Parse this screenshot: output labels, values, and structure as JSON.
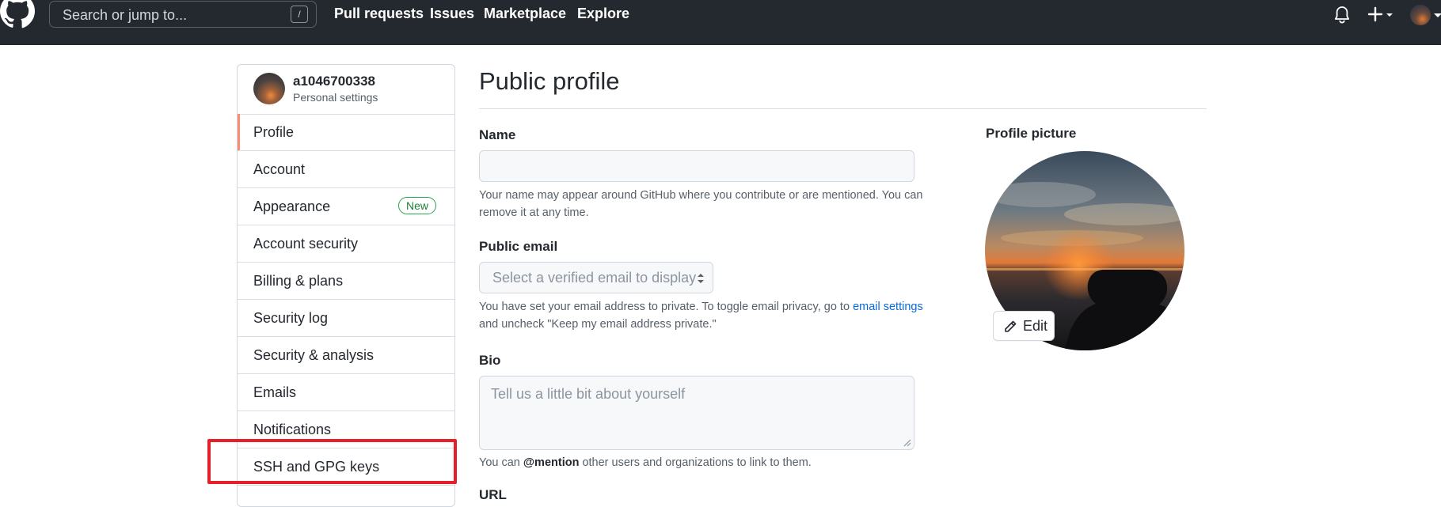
{
  "header": {
    "search_placeholder": "Search or jump to...",
    "search_shortcut": "/",
    "nav": [
      "Pull requests",
      "Issues",
      "Marketplace",
      "Explore"
    ],
    "icons": [
      "github-logo-icon",
      "bell-icon",
      "plus-icon",
      "caret-down-icon",
      "avatar"
    ]
  },
  "sidebar": {
    "username": "a1046700338",
    "subtitle": "Personal settings",
    "items": [
      {
        "label": "Profile",
        "active": true
      },
      {
        "label": "Account"
      },
      {
        "label": "Appearance",
        "badge": "New"
      },
      {
        "label": "Account security"
      },
      {
        "label": "Billing & plans"
      },
      {
        "label": "Security log"
      },
      {
        "label": "Security & analysis"
      },
      {
        "label": "Emails"
      },
      {
        "label": "Notifications"
      },
      {
        "label": "SSH and GPG keys",
        "highlighted": true
      }
    ]
  },
  "main": {
    "title": "Public profile",
    "name_label": "Name",
    "name_value": "",
    "name_help": "Your name may appear around GitHub where you contribute or are mentioned. You can remove it at any time.",
    "email_label": "Public email",
    "email_placeholder": "Select a verified email to display",
    "email_help_pre": "You have set your email address to private. To toggle email privacy, go to ",
    "email_help_link": "email settings",
    "email_help_post": "and uncheck \"Keep my email address private.\"",
    "bio_label": "Bio",
    "bio_placeholder": "Tell us a little bit about yourself",
    "bio_help_pre": "You can ",
    "bio_help_mention": "@mention",
    "bio_help_post": " other users and organizations to link to them.",
    "url_label": "URL"
  },
  "profile_picture": {
    "label": "Profile picture",
    "edit_label": "Edit"
  },
  "colors": {
    "header_bg": "#24292f",
    "active_marker": "#fd8c73",
    "badge_green": "#1a7f37",
    "link_blue": "#0969da",
    "annotation_red": "#e5202a"
  }
}
